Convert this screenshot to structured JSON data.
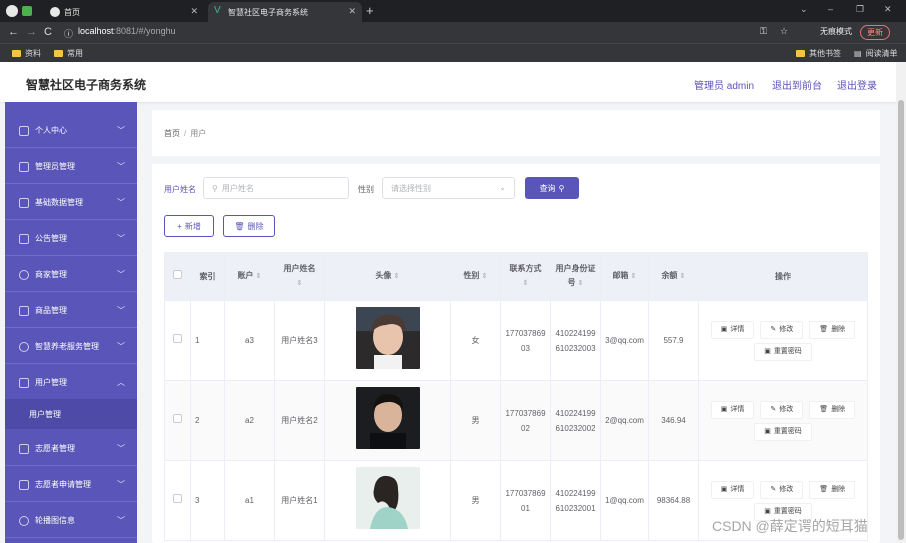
{
  "browser": {
    "tabs": [
      {
        "title": "首页",
        "active": false
      },
      {
        "title": "智慧社区电子商务系统",
        "active": true
      }
    ],
    "url_host": "localhost",
    "url_path": ":8081/#/yonghu",
    "incognito_label": "无痕模式",
    "update_label": "更新",
    "bookmarks": [
      "资料",
      "常用"
    ],
    "bookmarks_right": [
      "其他书签",
      "阅读清单"
    ]
  },
  "header": {
    "app_title": "智慧社区电子商务系统",
    "admin_label": "管理员 admin",
    "front_link": "退出到前台",
    "logout_link": "退出登录"
  },
  "sidebar": {
    "items": [
      {
        "label": "个人中心",
        "expanded": false
      },
      {
        "label": "管理员管理",
        "expanded": false
      },
      {
        "label": "基础数据管理",
        "expanded": false
      },
      {
        "label": "公告管理",
        "expanded": false
      },
      {
        "label": "商家管理",
        "expanded": false
      },
      {
        "label": "商品管理",
        "expanded": false
      },
      {
        "label": "智慧养老服务管理",
        "expanded": false
      },
      {
        "label": "用户管理",
        "expanded": true
      },
      {
        "label": "志愿者管理",
        "expanded": false
      },
      {
        "label": "志愿者申请管理",
        "expanded": false
      },
      {
        "label": "轮播图信息",
        "expanded": false
      }
    ],
    "sub_item": "用户管理"
  },
  "breadcrumb": {
    "home": "首页",
    "sep": "/",
    "current": "用户"
  },
  "search": {
    "name_label": "用户姓名",
    "name_placeholder": "用户姓名",
    "gender_label": "性别",
    "gender_placeholder": "请选择性别",
    "query_button": "查询"
  },
  "actions": {
    "add": "新增",
    "delete": "删除"
  },
  "table": {
    "headers": [
      "索引",
      "账户",
      "用户姓名",
      "头像",
      "性别",
      "联系方式",
      "用户身份证号",
      "邮箱",
      "余额",
      "操作"
    ],
    "rows": [
      {
        "index": "1",
        "account": "a3",
        "name": "用户姓名3",
        "gender": "女",
        "phone": "17703786903",
        "idcard": "410224199610232003",
        "email": "3@qq.com",
        "balance": "557.9"
      },
      {
        "index": "2",
        "account": "a2",
        "name": "用户姓名2",
        "gender": "男",
        "phone": "17703786902",
        "idcard": "410224199610232002",
        "email": "2@qq.com",
        "balance": "346.94"
      },
      {
        "index": "3",
        "account": "a1",
        "name": "用户姓名1",
        "gender": "男",
        "phone": "17703786901",
        "idcard": "410224199610232001",
        "email": "1@qq.com",
        "balance": "98364.88"
      }
    ],
    "ops": {
      "detail": "详情",
      "edit": "修改",
      "delete": "删除",
      "reset": "重置密码"
    }
  },
  "colors": {
    "brand": "#5a56b9",
    "brand_dark": "#4e4aa8",
    "link": "#5b53b8"
  },
  "watermark": "CSDN @薛定谔的短耳猫"
}
